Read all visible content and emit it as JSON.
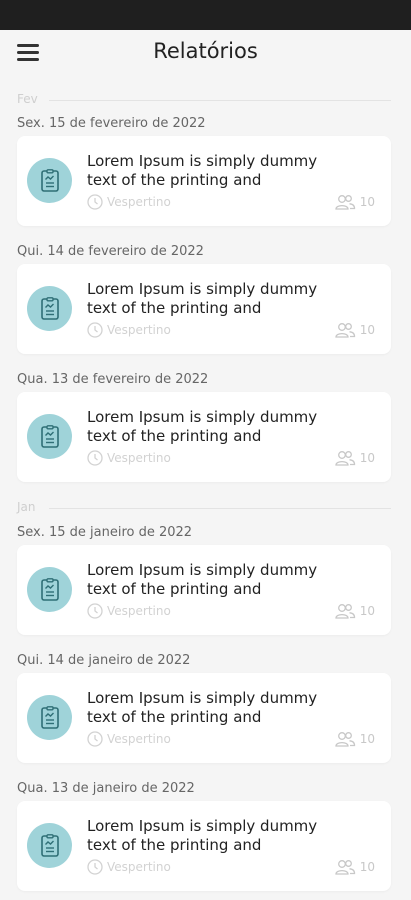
{
  "header": {
    "title": "Relatórios"
  },
  "groups": [
    {
      "month": "Fev",
      "items": [
        {
          "date": "Sex. 15 de fevereiro de 2022",
          "title_line1": "Lorem Ipsum is simply dummy",
          "title_line2": "text of the printing and",
          "shift": "Vespertino",
          "count": "10"
        },
        {
          "date": "Qui. 14 de fevereiro de 2022",
          "title_line1": "Lorem Ipsum is simply dummy",
          "title_line2": "text of the printing and",
          "shift": "Vespertino",
          "count": "10"
        },
        {
          "date": "Qua. 13 de fevereiro de 2022",
          "title_line1": "Lorem Ipsum is simply dummy",
          "title_line2": "text of the printing and",
          "shift": "Vespertino",
          "count": "10"
        }
      ]
    },
    {
      "month": "Jan",
      "items": [
        {
          "date": "Sex. 15 de janeiro de 2022",
          "title_line1": "Lorem Ipsum is simply dummy",
          "title_line2": "text of the printing and",
          "shift": "Vespertino",
          "count": "10"
        },
        {
          "date": "Qui. 14 de janeiro de 2022",
          "title_line1": "Lorem Ipsum is simply dummy",
          "title_line2": "text of the printing and",
          "shift": "Vespertino",
          "count": "10"
        },
        {
          "date": "Qua. 13 de janeiro de 2022",
          "title_line1": "Lorem Ipsum is simply dummy",
          "title_line2": "text of the printing and",
          "shift": "Vespertino",
          "count": "10"
        }
      ]
    }
  ],
  "colors": {
    "icon_circle": "#9fd3d9",
    "icon_stroke": "#2f6f76",
    "status_bar": "#1f1f1f"
  }
}
